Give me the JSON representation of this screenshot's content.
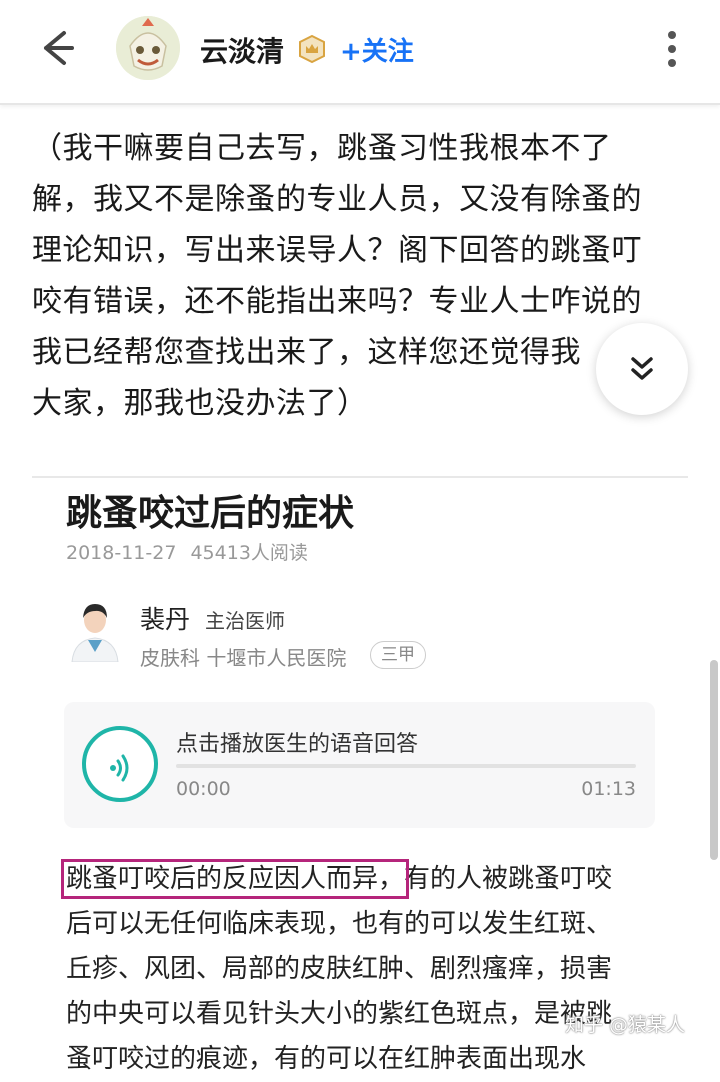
{
  "header": {
    "author_name": "云淡清",
    "follow_label": "+关注",
    "icons": {
      "back": "arrow-left-icon",
      "badge": "crown-badge-icon",
      "more": "more-vertical-icon"
    }
  },
  "intro_lines": [
    "（我干嘛要自己去写，跳蚤习性我根本不了",
    "解，我又不是除蚤的专业人员，又没有除蚤的",
    "理论知识，写出来误导人？阁下回答的跳蚤叮",
    "咬有错误，还不能指出来吗？专业人士咋说的",
    "我已经帮您查找出来了，这样您还觉得我",
    "大家，那我也没办法了）"
  ],
  "fab_icon": "chevrons-down-icon",
  "card": {
    "title": "跳蚤咬过后的症状",
    "date": "2018-11-27",
    "reads": "45413人阅读",
    "doctor_name": "裴丹",
    "doctor_title": "主治医师",
    "department": "皮肤科 十堰市人民医院",
    "hospital_level": "三甲",
    "audio_label": "点击播放医生的语音回答",
    "audio_progress": 0,
    "time_start": "00:00",
    "time_end": "01:13",
    "body_highlight": "跳蚤叮咬后的反应因人而异，",
    "body_first_rest": "有的人被跳蚤叮咬",
    "body_lines": [
      "后可以无任何临床表现，也有的可以发生红斑、",
      "丘疹、风团、局部的皮肤红肿、剧烈瘙痒，损害",
      "的中央可以看见针头大小的紫红色斑点，是被跳",
      "蚤叮咬过的痕迹，有的可以在红肿表面出现水"
    ]
  },
  "watermark": "知乎 @猿某人",
  "colors": {
    "accent": "#1772f6",
    "audio": "#1fb5a8",
    "highlight_box": "#b5257b"
  }
}
